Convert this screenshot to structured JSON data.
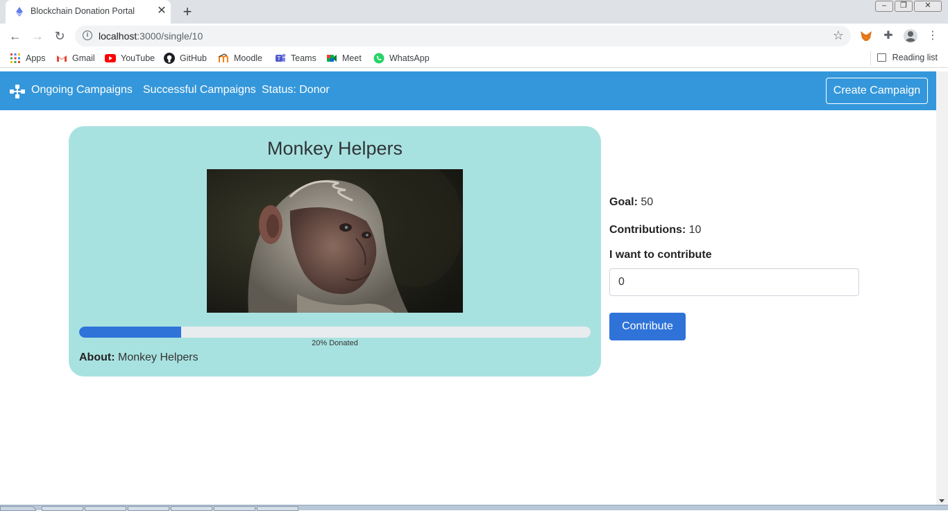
{
  "browser": {
    "tab_title": "Blockchain Donation Portal",
    "new_tab": "+",
    "tab_close": "✕",
    "url_host": "localhost",
    "url_path": ":3000/single/10",
    "bookmarks": [
      "Apps",
      "Gmail",
      "YouTube",
      "GitHub",
      "Moodle",
      "Teams",
      "Meet",
      "WhatsApp"
    ],
    "reading_list": "Reading list"
  },
  "navbar": {
    "links": [
      "Ongoing Campaigns",
      "Successful Campaigns",
      "Status: Donor"
    ],
    "create_label": "Create Campaign"
  },
  "campaign": {
    "title": "Monkey Helpers",
    "progress_percent": 20,
    "progress_label": "20% Donated",
    "about_label": "About:",
    "about_text": "Monkey Helpers",
    "goal_label": "Goal:",
    "goal_value": "50",
    "contributions_label": "Contributions:",
    "contributions_value": "10",
    "want_label": "I want to contribute",
    "amount_value": "0",
    "contribute_label": "Contribute"
  },
  "colors": {
    "navbar": "#3497db",
    "card": "#a8e2e0",
    "primary": "#2f73d9"
  },
  "icons": {
    "favicon": "ethereum-icon",
    "brand": "network-icon"
  }
}
